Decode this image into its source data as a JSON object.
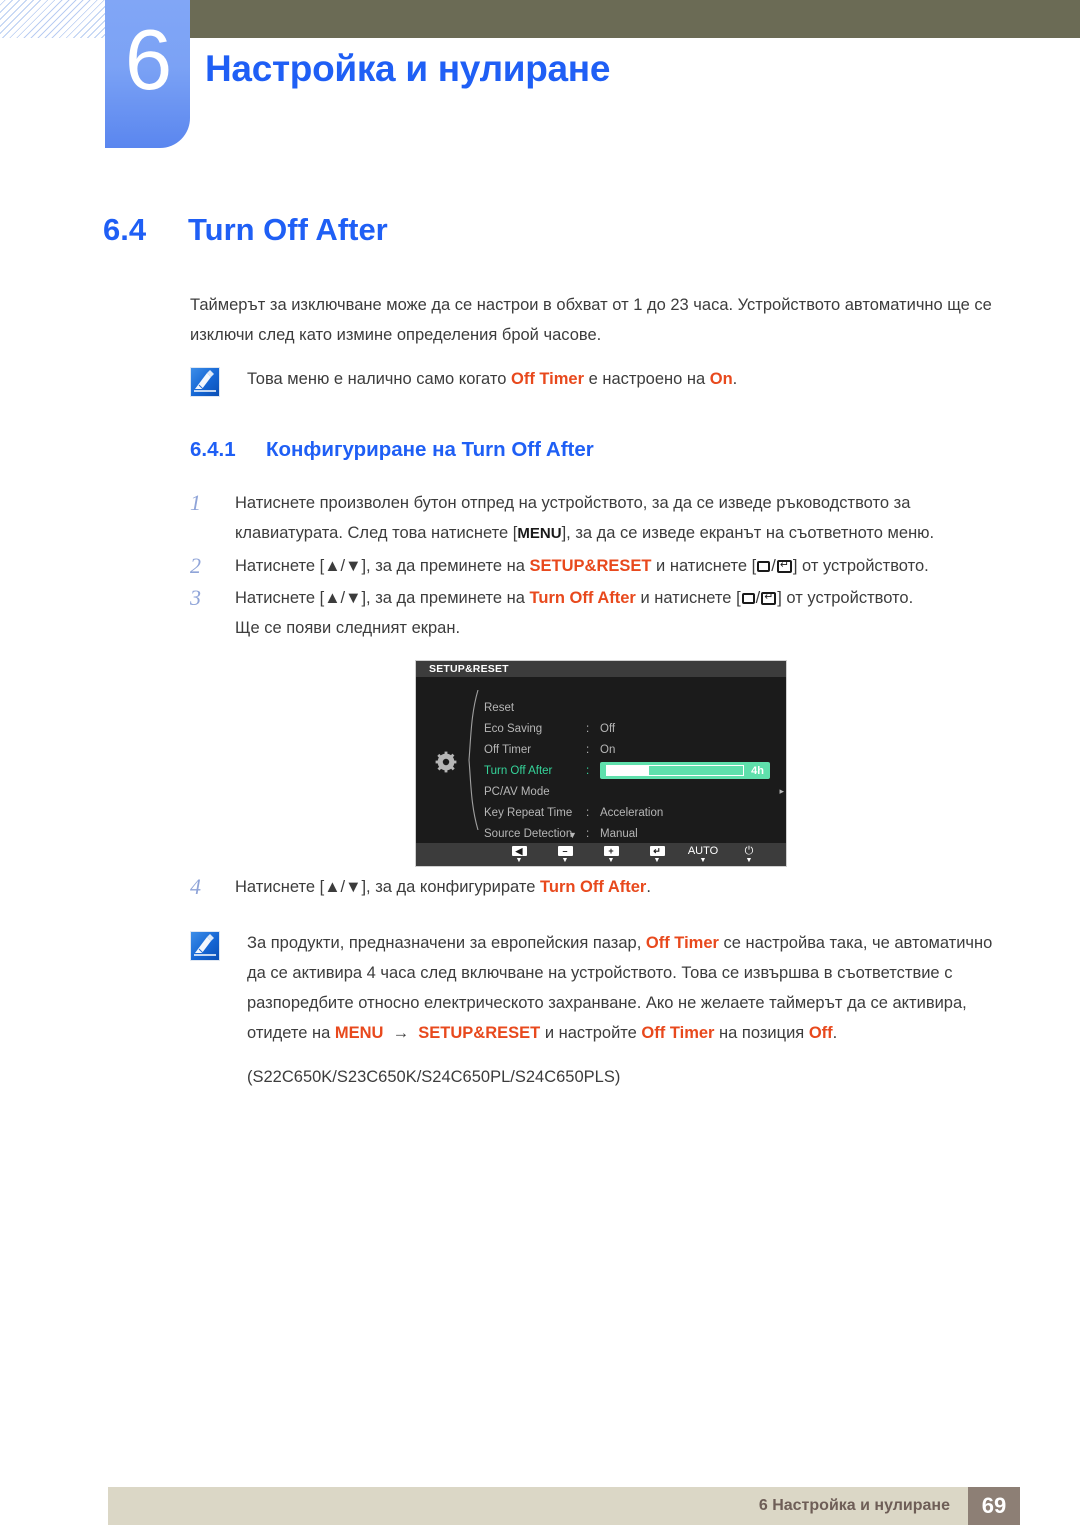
{
  "header": {
    "chapter_number": "6",
    "chapter_title": "Настройка и нулиране"
  },
  "section": {
    "number": "6.4",
    "title": "Turn Off After"
  },
  "intro": {
    "paragraph": "Таймерът за изключване може да се настрои в обхват от 1 до 23 часа. Устройството автоматично ще се изключи след като измине определения брой часове.",
    "note_prefix": "Това меню е налично само когато ",
    "note_kw1": "Off Timer",
    "note_mid": " е настроено на ",
    "note_kw2": "On",
    "note_suffix": ".",
    "note_icon": "note-pen-icon"
  },
  "subsection": {
    "number": "6.4.1",
    "title": "Конфигуриране на Turn Off After"
  },
  "steps": [
    {
      "num": "1",
      "part1": "Натиснете произволен бутон отпред на устройството, за да се изведе ръководството за клавиатурата. След това натиснете [",
      "key": "MENU",
      "part2": "], за да се изведе екранът на съответното меню."
    },
    {
      "num": "2",
      "part1": "Натиснете [▲/▼], за да преминете на ",
      "kw": "SETUP&RESET",
      "part2": " и натиснете [",
      "part3": "] от устройството."
    },
    {
      "num": "3",
      "part1": "Натиснете [▲/▼], за да преминете на ",
      "kw": "Turn Off After",
      "part2": " и натиснете [",
      "part3": "] от устройството.",
      "extra": "Ще се появи следният екран."
    },
    {
      "num": "4",
      "part1": "Натиснете [▲/▼], за да конфигурирате ",
      "kw": "Turn Off After",
      "part2": "."
    }
  ],
  "osd": {
    "title": "SETUP&RESET",
    "gear_icon": "gear-icon",
    "rows": [
      {
        "label": "Reset",
        "colon": "",
        "value": "",
        "selected": false,
        "type": "plain"
      },
      {
        "label": "Eco Saving",
        "colon": ":",
        "value": "Off",
        "selected": false,
        "type": "plain"
      },
      {
        "label": "Off Timer",
        "colon": ":",
        "value": "On",
        "selected": false,
        "type": "plain"
      },
      {
        "label": "Turn Off After",
        "colon": ":",
        "value": "4h",
        "selected": true,
        "type": "slider",
        "fill_percent": 30
      },
      {
        "label": "PC/AV Mode",
        "colon": "",
        "value": "",
        "selected": false,
        "type": "submenu",
        "arrow": "▸"
      },
      {
        "label": "Key Repeat Time",
        "colon": ":",
        "value": "Acceleration",
        "selected": false,
        "type": "plain"
      },
      {
        "label": "Source Detection",
        "colon": ":",
        "value": "Manual",
        "selected": false,
        "type": "plain"
      }
    ],
    "scroll_caret": "▼",
    "buttons": [
      {
        "name": "back-button",
        "glyph": "◀",
        "tri": "▼"
      },
      {
        "name": "minus-button",
        "glyph": "–",
        "tri": "▼"
      },
      {
        "name": "plus-button",
        "glyph": "+",
        "tri": "▼"
      },
      {
        "name": "enter-button",
        "glyph": "↵",
        "tri": "▼"
      },
      {
        "name": "auto-button",
        "glyph": "AUTO",
        "tri": "▼"
      },
      {
        "name": "power-button",
        "glyph": "⏻",
        "tri": "▼"
      }
    ]
  },
  "bottom_note": {
    "icon": "note-pen-icon",
    "p1_a": "За продукти, предназначени за европейския пазар, ",
    "p1_kw": "Off Timer",
    "p1_b": " се настройва така, че автоматично да се активира 4 часа след включване на устройството. Това се извършва в съответствие с разпоредбите относно електрическото захранване. Ако не желаете таймерът да се активира, отидете на ",
    "p1_kw2": "MENU",
    "p1_arrow": "→",
    "p1_kw3": "SETUP&RESET",
    "p1_c": " и настройте ",
    "p1_kw4": "Off Timer",
    "p1_d": " на позиция ",
    "p1_kw5": "Off",
    "p1_e": ".",
    "models": "(S22C650K/S23C650K/S24C650PL/S24C650PLS)"
  },
  "footer": {
    "text": "6 Настройка и нулиране",
    "page": "69"
  },
  "colors": {
    "accent_blue": "#1f5ff5",
    "keyword_orange": "#e8491d",
    "olive": "#6b6b55",
    "chapter_blue": "#7ba2f5",
    "footer_bg": "#dbd7c6",
    "footer_box": "#8d7f75",
    "osd_green": "#35d49a"
  }
}
